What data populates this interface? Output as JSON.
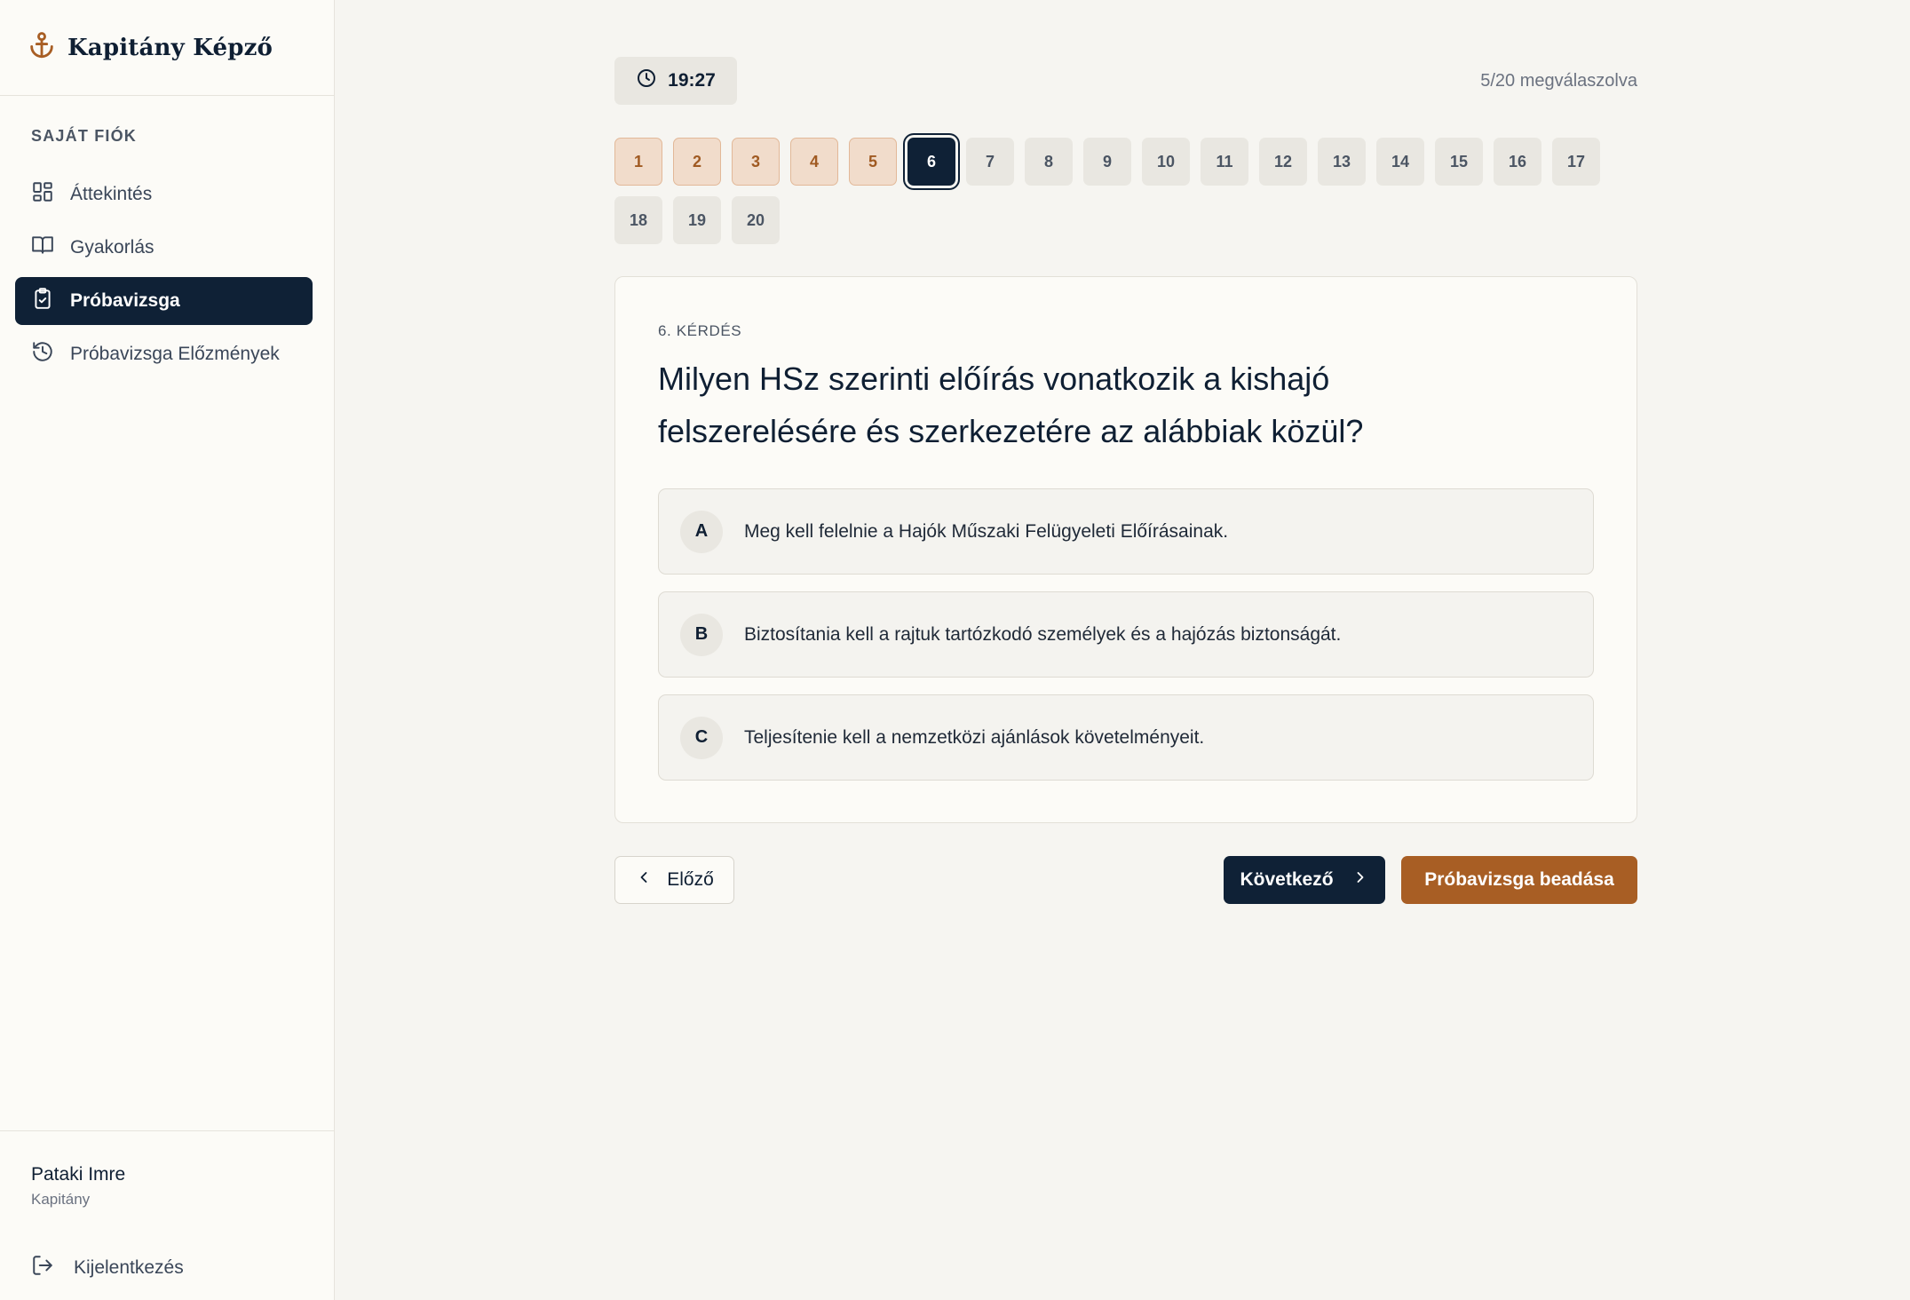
{
  "app": {
    "brand_name": "Kapitány Képző",
    "brand_icon": "anchor-icon",
    "accent_color": "#a85e24",
    "primary_color": "#0f2136"
  },
  "sidebar": {
    "section_label": "SAJÁT FIÓK",
    "items": [
      {
        "label": "Áttekintés",
        "icon": "dashboard-icon",
        "active": false
      },
      {
        "label": "Gyakorlás",
        "icon": "book-icon",
        "active": false
      },
      {
        "label": "Próbavizsga",
        "icon": "clipboard-check-icon",
        "active": true
      },
      {
        "label": "Próbavizsga Előzmények",
        "icon": "history-icon",
        "active": false
      }
    ],
    "user": {
      "name": "Pataki Imre",
      "role": "Kapitány"
    },
    "logout_label": "Kijelentkezés"
  },
  "exam": {
    "timer": "19:27",
    "answered_status": "5/20 megválaszolva",
    "questions": [
      {
        "number": "1",
        "state": "answered"
      },
      {
        "number": "2",
        "state": "answered"
      },
      {
        "number": "3",
        "state": "answered"
      },
      {
        "number": "4",
        "state": "answered"
      },
      {
        "number": "5",
        "state": "answered"
      },
      {
        "number": "6",
        "state": "current"
      },
      {
        "number": "7",
        "state": "open"
      },
      {
        "number": "8",
        "state": "open"
      },
      {
        "number": "9",
        "state": "open"
      },
      {
        "number": "10",
        "state": "open"
      },
      {
        "number": "11",
        "state": "open"
      },
      {
        "number": "12",
        "state": "open"
      },
      {
        "number": "13",
        "state": "open"
      },
      {
        "number": "14",
        "state": "open"
      },
      {
        "number": "15",
        "state": "open"
      },
      {
        "number": "16",
        "state": "open"
      },
      {
        "number": "17",
        "state": "open"
      },
      {
        "number": "18",
        "state": "open"
      },
      {
        "number": "19",
        "state": "open"
      },
      {
        "number": "20",
        "state": "open"
      }
    ],
    "current_question": {
      "label": "6. KÉRDÉS",
      "text": "Milyen HSz szerinti előírás vonatkozik a kishajó felszerelésére és szerkezetére az alábbiak közül?",
      "options": [
        {
          "letter": "A",
          "text": "Meg kell felelnie a Hajók Műszaki Felügyeleti Előírásainak."
        },
        {
          "letter": "B",
          "text": "Biztosítania kell a rajtuk tartózkodó személyek és a hajózás biztonságát."
        },
        {
          "letter": "C",
          "text": "Teljesítenie kell a nemzetközi ajánlások követelményeit."
        }
      ]
    },
    "prev_label": "Előző",
    "next_label": "Következő",
    "submit_label": "Próbavizsga beadása"
  }
}
